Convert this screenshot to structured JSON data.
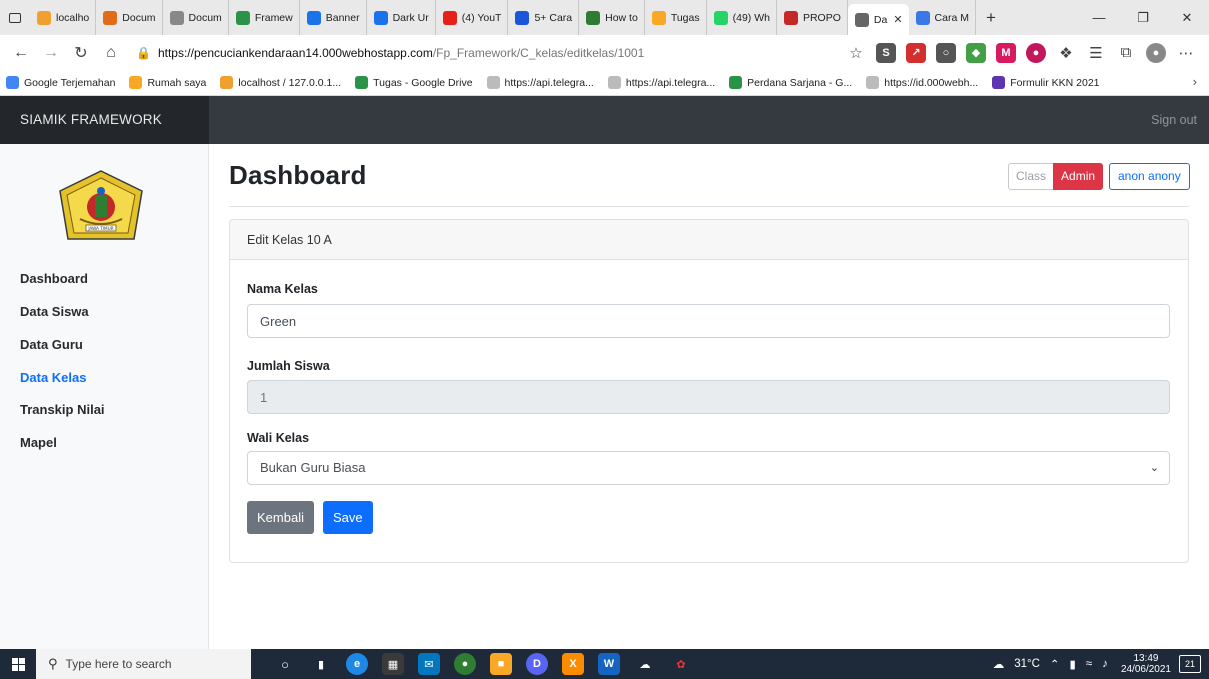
{
  "browser": {
    "tabs": [
      {
        "label": "localho",
        "color": "#f0a030"
      },
      {
        "label": "Docum",
        "color": "#e06c1a"
      },
      {
        "label": "Docum",
        "color": "#888888"
      },
      {
        "label": "Framew",
        "color": "#2b9348"
      },
      {
        "label": "Banner",
        "color": "#1a73e8"
      },
      {
        "label": "Dark Ur",
        "color": "#1a73e8"
      },
      {
        "label": "(4) YouT",
        "color": "#e62117"
      },
      {
        "label": "5+ Cara",
        "color": "#1a56db"
      },
      {
        "label": "How to",
        "color": "#2e7d32"
      },
      {
        "label": "Tugas",
        "color": "#f9a825"
      },
      {
        "label": "(49) Wh",
        "color": "#25d366"
      },
      {
        "label": "PROPO",
        "color": "#c62828"
      },
      {
        "label": "Da",
        "color": "#666666",
        "active": true
      },
      {
        "label": "Cara M",
        "color": "#3b78e7"
      }
    ],
    "url_host": "https://pencuciankendaraan14.000webhostapp.com",
    "url_path": "/Fp_Framework/C_kelas/editkelas/1001",
    "bookmarks": [
      {
        "label": "Google Terjemahan",
        "color": "#4285f4"
      },
      {
        "label": "Rumah saya",
        "color": "#f9a825"
      },
      {
        "label": "localhost / 127.0.0.1...",
        "color": "#f0a030"
      },
      {
        "label": "Tugas - Google Drive",
        "color": "#2b9348"
      },
      {
        "label": "https://api.telegra...",
        "color": "#bbbbbb"
      },
      {
        "label": "https://api.telegra...",
        "color": "#bbbbbb"
      },
      {
        "label": "Perdana Sarjana - G...",
        "color": "#2b9348"
      },
      {
        "label": "https://id.000webh...",
        "color": "#bbbbbb"
      },
      {
        "label": "Formulir KKN 2021",
        "color": "#5e35b1"
      }
    ]
  },
  "navbar": {
    "brand": "SIAMIK FRAMEWORK",
    "signout": "Sign out"
  },
  "sidebar": {
    "items": [
      {
        "label": "Dashboard",
        "active": false
      },
      {
        "label": "Data Siswa",
        "active": false
      },
      {
        "label": "Data Guru",
        "active": false
      },
      {
        "label": "Data Kelas",
        "active": true
      },
      {
        "label": "Transkip Nilai",
        "active": false
      },
      {
        "label": "Mapel",
        "active": false
      }
    ],
    "logo_text": "JAWA TIMUR"
  },
  "main": {
    "title": "Dashboard",
    "class_label": "Class",
    "admin_label": "Admin",
    "user_label": "anon anony",
    "card_header": "Edit Kelas 10 A",
    "form": {
      "nama_kelas_label": "Nama Kelas",
      "nama_kelas_value": "Green",
      "jumlah_siswa_label": "Jumlah Siswa",
      "jumlah_siswa_value": "1",
      "wali_kelas_label": "Wali Kelas",
      "wali_kelas_value": "Bukan Guru Biasa"
    },
    "back_label": "Kembali",
    "save_label": "Save"
  },
  "taskbar": {
    "search_placeholder": "Type here to search",
    "temperature": "31°C",
    "time": "13:49",
    "date": "24/06/2021",
    "notifications": "21"
  },
  "colors": {
    "navbar": "#343a40",
    "accent": "#0d6efd",
    "danger": "#dc3545",
    "secondary": "#6c757d"
  }
}
